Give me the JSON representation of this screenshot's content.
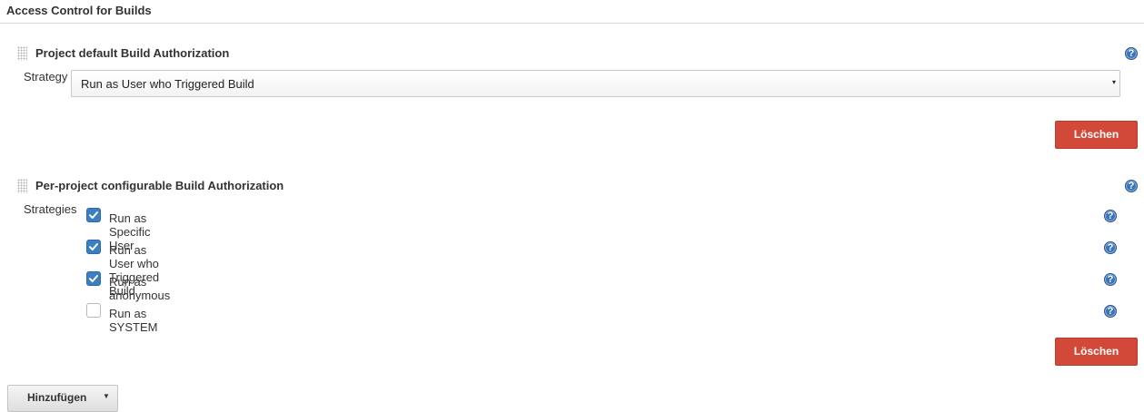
{
  "section": {
    "title": "Access Control for Builds"
  },
  "project_default": {
    "title": "Project default Build Authorization",
    "strategy_label": "Strategy",
    "strategy_value": "Run as User who Triggered Build",
    "delete_label": "Löschen",
    "help_glyph": "?"
  },
  "per_project": {
    "title": "Per-project configurable Build Authorization",
    "strategies_label": "Strategies",
    "delete_label": "Löschen",
    "help_glyph": "?",
    "options": [
      {
        "label": "Run as Specific User",
        "checked": true,
        "help_glyph": "?"
      },
      {
        "label": "Run as User who Triggered Build",
        "checked": true,
        "help_glyph": "?"
      },
      {
        "label": "Run as anonymous",
        "checked": true,
        "help_glyph": "?"
      },
      {
        "label": "Run as SYSTEM",
        "checked": false,
        "help_glyph": "?"
      }
    ]
  },
  "add_button": {
    "label": "Hinzufügen"
  },
  "icons": {
    "help": "help-icon",
    "drag": "drag-handle-icon",
    "checkmark": "checkmark-icon",
    "dropdown": "dropdown-arrow-icon"
  },
  "colors": {
    "danger": "#d24939",
    "checkbox": "#3a7fc1",
    "help": "#3a75b9"
  }
}
